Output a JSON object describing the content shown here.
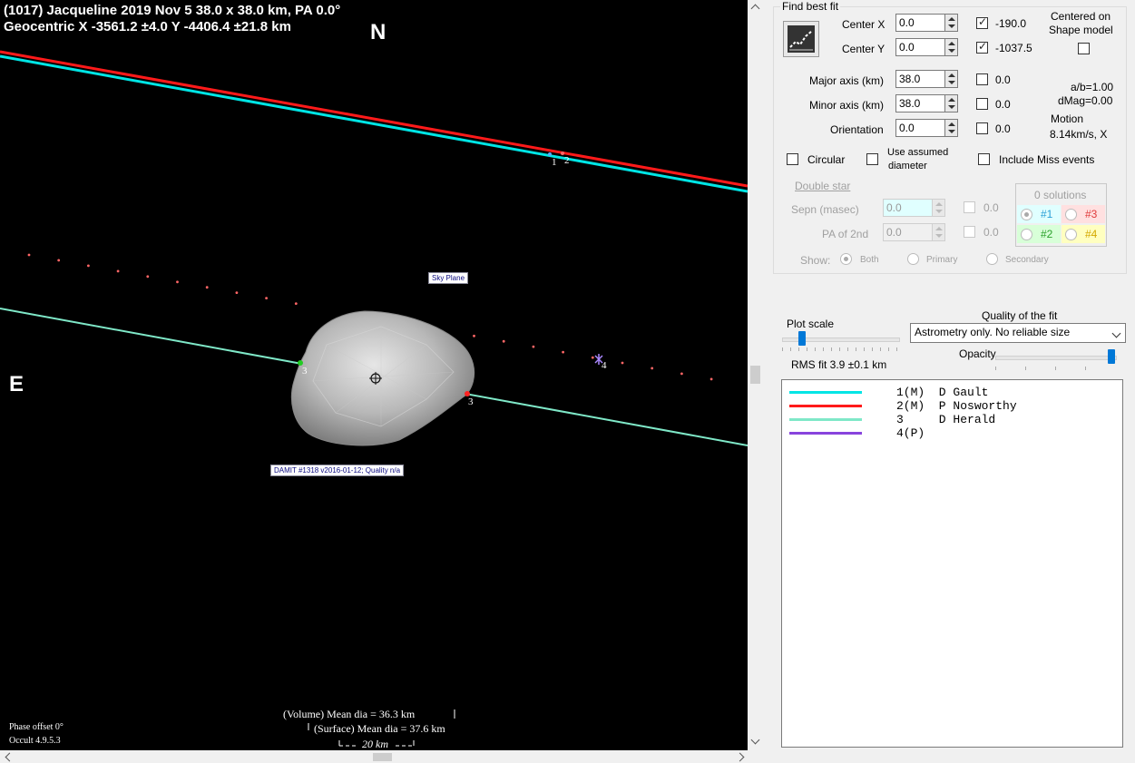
{
  "plot": {
    "title_line1": "(1017) Jacqueline  2019 Nov 5  38.0 x 38.0 km, PA 0.0°",
    "title_line2": "Geocentric  X  -3561.2 ±4.0  Y -4406.4 ±21.8 km",
    "north_label": "N",
    "east_label": "E",
    "sky_plane_tag": "Sky Plane",
    "damit_tag": "DAMIT #1318 v2016-01-12; Quality n/a",
    "chord_labels": [
      "1",
      "2",
      "3",
      "3",
      "4"
    ],
    "volume_dia": "(Volume) Mean dia = 36.3 km",
    "surface_dia": "(Surface) Mean dia = 37.6 km",
    "scale_bar": "20 km",
    "phase_offset": "Phase offset 0°",
    "version": "Occult 4.9.5.3",
    "colors": {
      "cyan": "#00e5e5",
      "red": "#ff1a1a",
      "aqua": "#7fe8c8",
      "purple": "#8844dd",
      "dots": "#ff6666"
    }
  },
  "fit": {
    "group_title": "Find best fit",
    "center_x_label": "Center X",
    "center_x": "0.0",
    "center_x_checked": true,
    "center_x_result": "-190.0",
    "center_y_label": "Center Y",
    "center_y": "0.0",
    "center_y_checked": true,
    "center_y_result": "-1037.5",
    "centered_on": "Centered on",
    "shape_model": "Shape model",
    "major_label": "Major axis (km)",
    "major": "38.0",
    "major_result": "0.0",
    "minor_label": "Minor axis (km)",
    "minor": "38.0",
    "minor_result": "0.0",
    "orient_label": "Orientation",
    "orient": "0.0",
    "orient_result": "0.0",
    "ab_ratio": "a/b=1.00",
    "dmag": "dMag=0.00",
    "motion_label": "Motion",
    "motion_value": "8.14km/s, X",
    "circular": "Circular",
    "use_assumed_1": "Use assumed",
    "use_assumed_2": "diameter",
    "include_miss": "Include Miss events"
  },
  "double_star": {
    "title": "Double star",
    "sepn_label": "Sepn (masec)",
    "sepn": "0.0",
    "sepn_result": "0.0",
    "pa_label": "PA of 2nd",
    "pa": "0.0",
    "pa_result": "0.0",
    "solutions": "0 solutions",
    "sol1": "#1",
    "sol2": "#2",
    "sol3": "#3",
    "sol4": "#4",
    "show_label": "Show:",
    "show_both": "Both",
    "show_primary": "Primary",
    "show_secondary": "Secondary"
  },
  "scale": {
    "plot_scale_label": "Plot scale",
    "quality_label": "Quality of the fit",
    "quality_value": "Astrometry only. No reliable size",
    "opacity_label": "Opacity",
    "rms_fit": "RMS fit 3.9 ±0.1 km"
  },
  "legend": [
    {
      "text": "1(M)  D Gault",
      "color": "#00e5e5"
    },
    {
      "text": "2(M)  P Nosworthy",
      "color": "#ff1a1a"
    },
    {
      "text": "3     D Herald",
      "color": "#7fe8c8"
    },
    {
      "text": "4(P)",
      "color": "#8844dd"
    }
  ]
}
